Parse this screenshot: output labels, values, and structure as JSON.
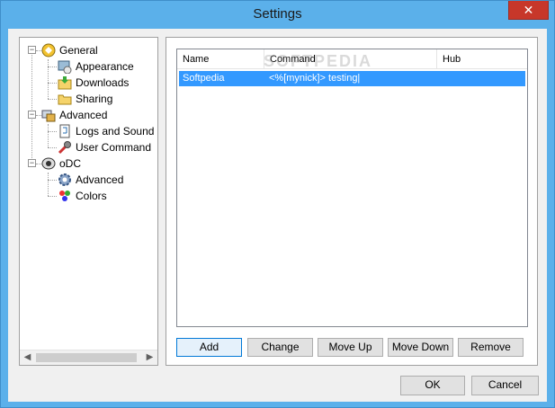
{
  "window": {
    "title": "Settings",
    "close_glyph": "✕"
  },
  "tree": {
    "items": [
      {
        "label": "General",
        "level": 0,
        "icon": "general-icon"
      },
      {
        "label": "Appearance",
        "level": 1,
        "icon": "appearance-icon"
      },
      {
        "label": "Downloads",
        "level": 1,
        "icon": "downloads-icon"
      },
      {
        "label": "Sharing",
        "level": 1,
        "icon": "sharing-icon"
      },
      {
        "label": "Advanced",
        "level": 0,
        "icon": "advanced-icon"
      },
      {
        "label": "Logs and Sound",
        "level": 1,
        "icon": "logs-icon"
      },
      {
        "label": "User Command",
        "level": 1,
        "icon": "user-command-icon"
      },
      {
        "label": "oDC",
        "level": 0,
        "icon": "odc-icon"
      },
      {
        "label": "Advanced",
        "level": 1,
        "icon": "gear-icon"
      },
      {
        "label": "Colors",
        "level": 1,
        "icon": "colors-icon"
      }
    ],
    "expander_glyph": "−"
  },
  "list": {
    "columns": [
      "Name",
      "Command",
      "Hub"
    ],
    "rows": [
      {
        "name": "Softpedia",
        "command": "<%[mynick]> testing|",
        "hub": ""
      }
    ],
    "watermark": "SOFTPEDIA"
  },
  "buttons": {
    "add": "Add",
    "change": "Change",
    "move_up": "Move Up",
    "move_down": "Move Down",
    "remove": "Remove",
    "ok": "OK",
    "cancel": "Cancel"
  },
  "colors": {
    "titlebar": "#5bb0ea",
    "selection": "#3399ff",
    "close": "#c7372a"
  }
}
